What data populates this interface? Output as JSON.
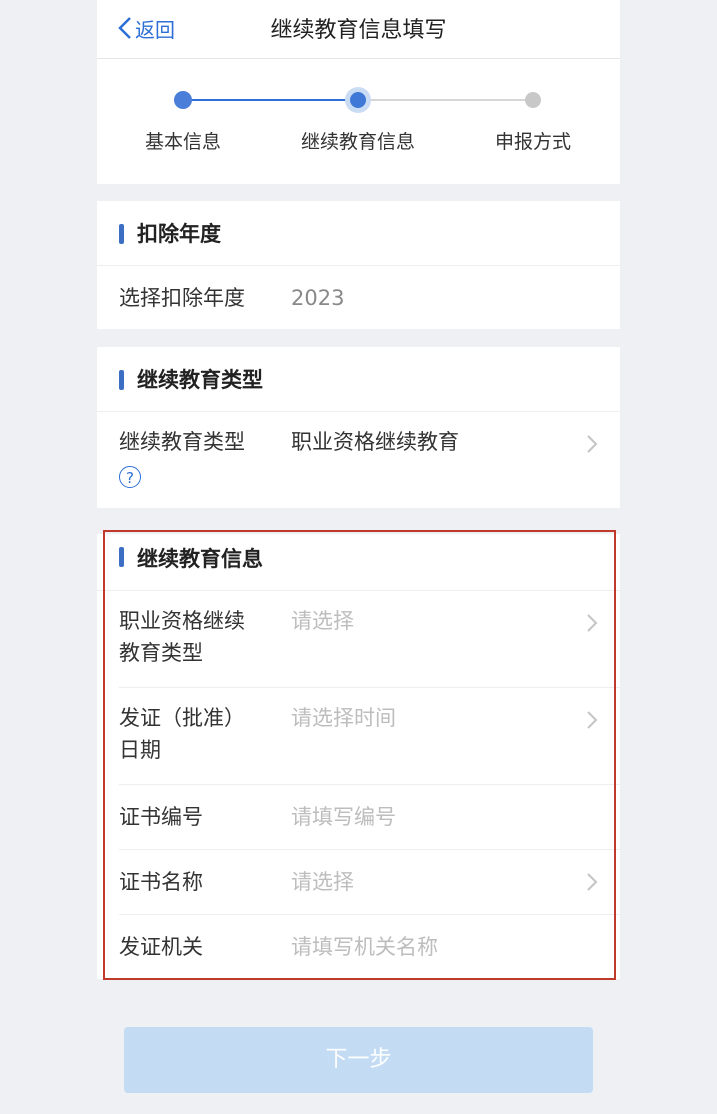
{
  "nav": {
    "back_label": "返回",
    "title": "继续教育信息填写"
  },
  "steps": [
    {
      "label": "基本信息",
      "state": "done"
    },
    {
      "label": "继续教育信息",
      "state": "current"
    },
    {
      "label": "申报方式",
      "state": "todo"
    }
  ],
  "section_year": {
    "title": "扣除年度",
    "label": "选择扣除年度",
    "value": "2023"
  },
  "section_type": {
    "title": "继续教育类型",
    "label": "继续教育类型",
    "value": "职业资格继续教育"
  },
  "section_info": {
    "title": "继续教育信息",
    "fields": [
      {
        "label_line1": "职业资格继续",
        "label_line2": "教育类型",
        "placeholder": "请选择",
        "has_arrow": true
      },
      {
        "label_line1": "发证（批准）",
        "label_line2": "日期",
        "placeholder": "请选择时间",
        "has_arrow": true
      },
      {
        "label": "证书编号",
        "placeholder": "请填写编号",
        "has_arrow": false
      },
      {
        "label": "证书名称",
        "placeholder": "请选择",
        "has_arrow": true
      },
      {
        "label": "发证机关",
        "placeholder": "请填写机关名称",
        "has_arrow": false
      }
    ]
  },
  "next_button": "下一步",
  "colors": {
    "accent": "#2d6fd6",
    "highlight_border": "#c0392b",
    "button_disabled": "#c3dcf4"
  }
}
